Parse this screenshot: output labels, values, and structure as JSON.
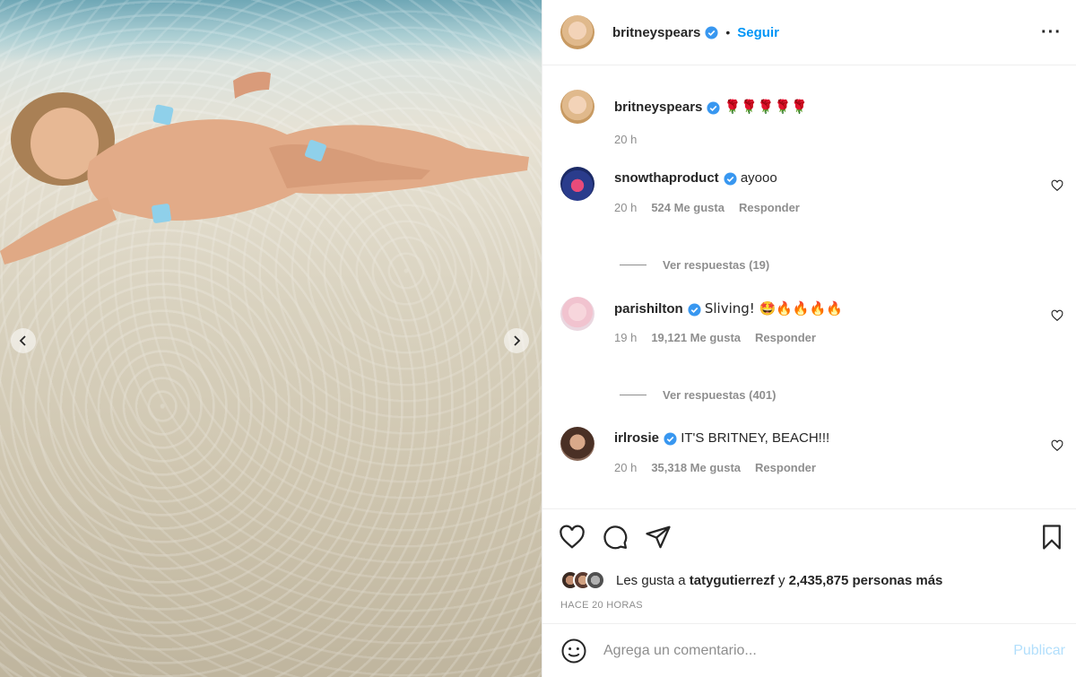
{
  "post": {
    "author": "britneyspears",
    "follow_label": "Seguir",
    "caption_emojis": "🌹🌹🌹🌹🌹",
    "caption_time": "20 h"
  },
  "comments": [
    {
      "user": "snowthaproduct",
      "text": "ayooo",
      "time": "20 h",
      "likes": "524 Me gusta",
      "reply": "Responder",
      "view_replies": "Ver respuestas (19)"
    },
    {
      "user": "parishilton",
      "text": "Sliving! 🤩🔥🔥🔥🔥",
      "time": "19 h",
      "likes": "19,121 Me gusta",
      "reply": "Responder",
      "view_replies": "Ver respuestas (401)"
    },
    {
      "user": "irlrosie",
      "text": "IT'S BRITNEY, BEACH!!!",
      "time": "20 h",
      "likes": "35,318 Me gusta",
      "reply": "Responder"
    }
  ],
  "likes": {
    "prefix": "Les gusta a",
    "user": "taty­gutierrezf",
    "middle": "y",
    "rest": "2,435,875 personas más"
  },
  "timestamp": "HACE 20 HORAS",
  "add_comment": {
    "placeholder": "Agrega un comentario...",
    "publish": "Publicar"
  },
  "icons": {
    "verified": "verified-badge-icon",
    "more": "more-options-icon",
    "like": "heart-icon",
    "comment": "comment-icon",
    "share": "share-icon",
    "save": "bookmark-icon",
    "emoji": "smile-icon",
    "prev": "chevron-left-icon",
    "next": "chevron-right-icon"
  },
  "colors": {
    "accent": "#0095f6",
    "verified": "#3897f0",
    "muted": "#8e8e8e",
    "publish_disabled": "#b2dffc"
  }
}
